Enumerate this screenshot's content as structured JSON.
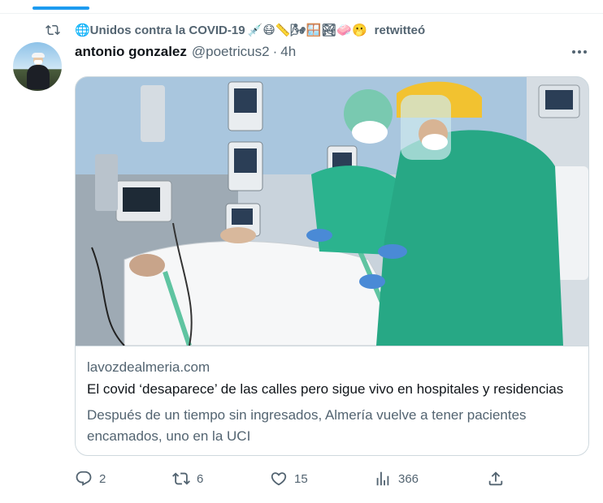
{
  "retweet": {
    "context_prefix": "🌐Unidos contra la COVID-19",
    "context_emojis": "💉😷📏🌬🪟🏞🧼🫢",
    "action": "retwitteó"
  },
  "tweet": {
    "display_name": "antonio gonzalez",
    "handle": "@poetricus2",
    "separator": "·",
    "time": "4h"
  },
  "card": {
    "domain": "lavozdealmeria.com",
    "title": "El covid ‘desaparece’ de las calles pero sigue vivo en hospitales y residencias",
    "description": "Después de un tiempo sin ingresados, Almería vuelve a tener pacientes encamados, uno en la UCI"
  },
  "actions": {
    "replies": "2",
    "retweets": "6",
    "likes": "15",
    "views": "366"
  },
  "colors": {
    "accent": "#1d9bf0",
    "secondary_text": "#536471",
    "primary_text": "#0f1419",
    "border": "#cfd9de",
    "scrubs": "#2bb38e"
  },
  "icons": [
    "retweet-icon",
    "more-icon",
    "reply-icon",
    "retweet-action-icon",
    "like-icon",
    "views-icon",
    "share-icon"
  ]
}
